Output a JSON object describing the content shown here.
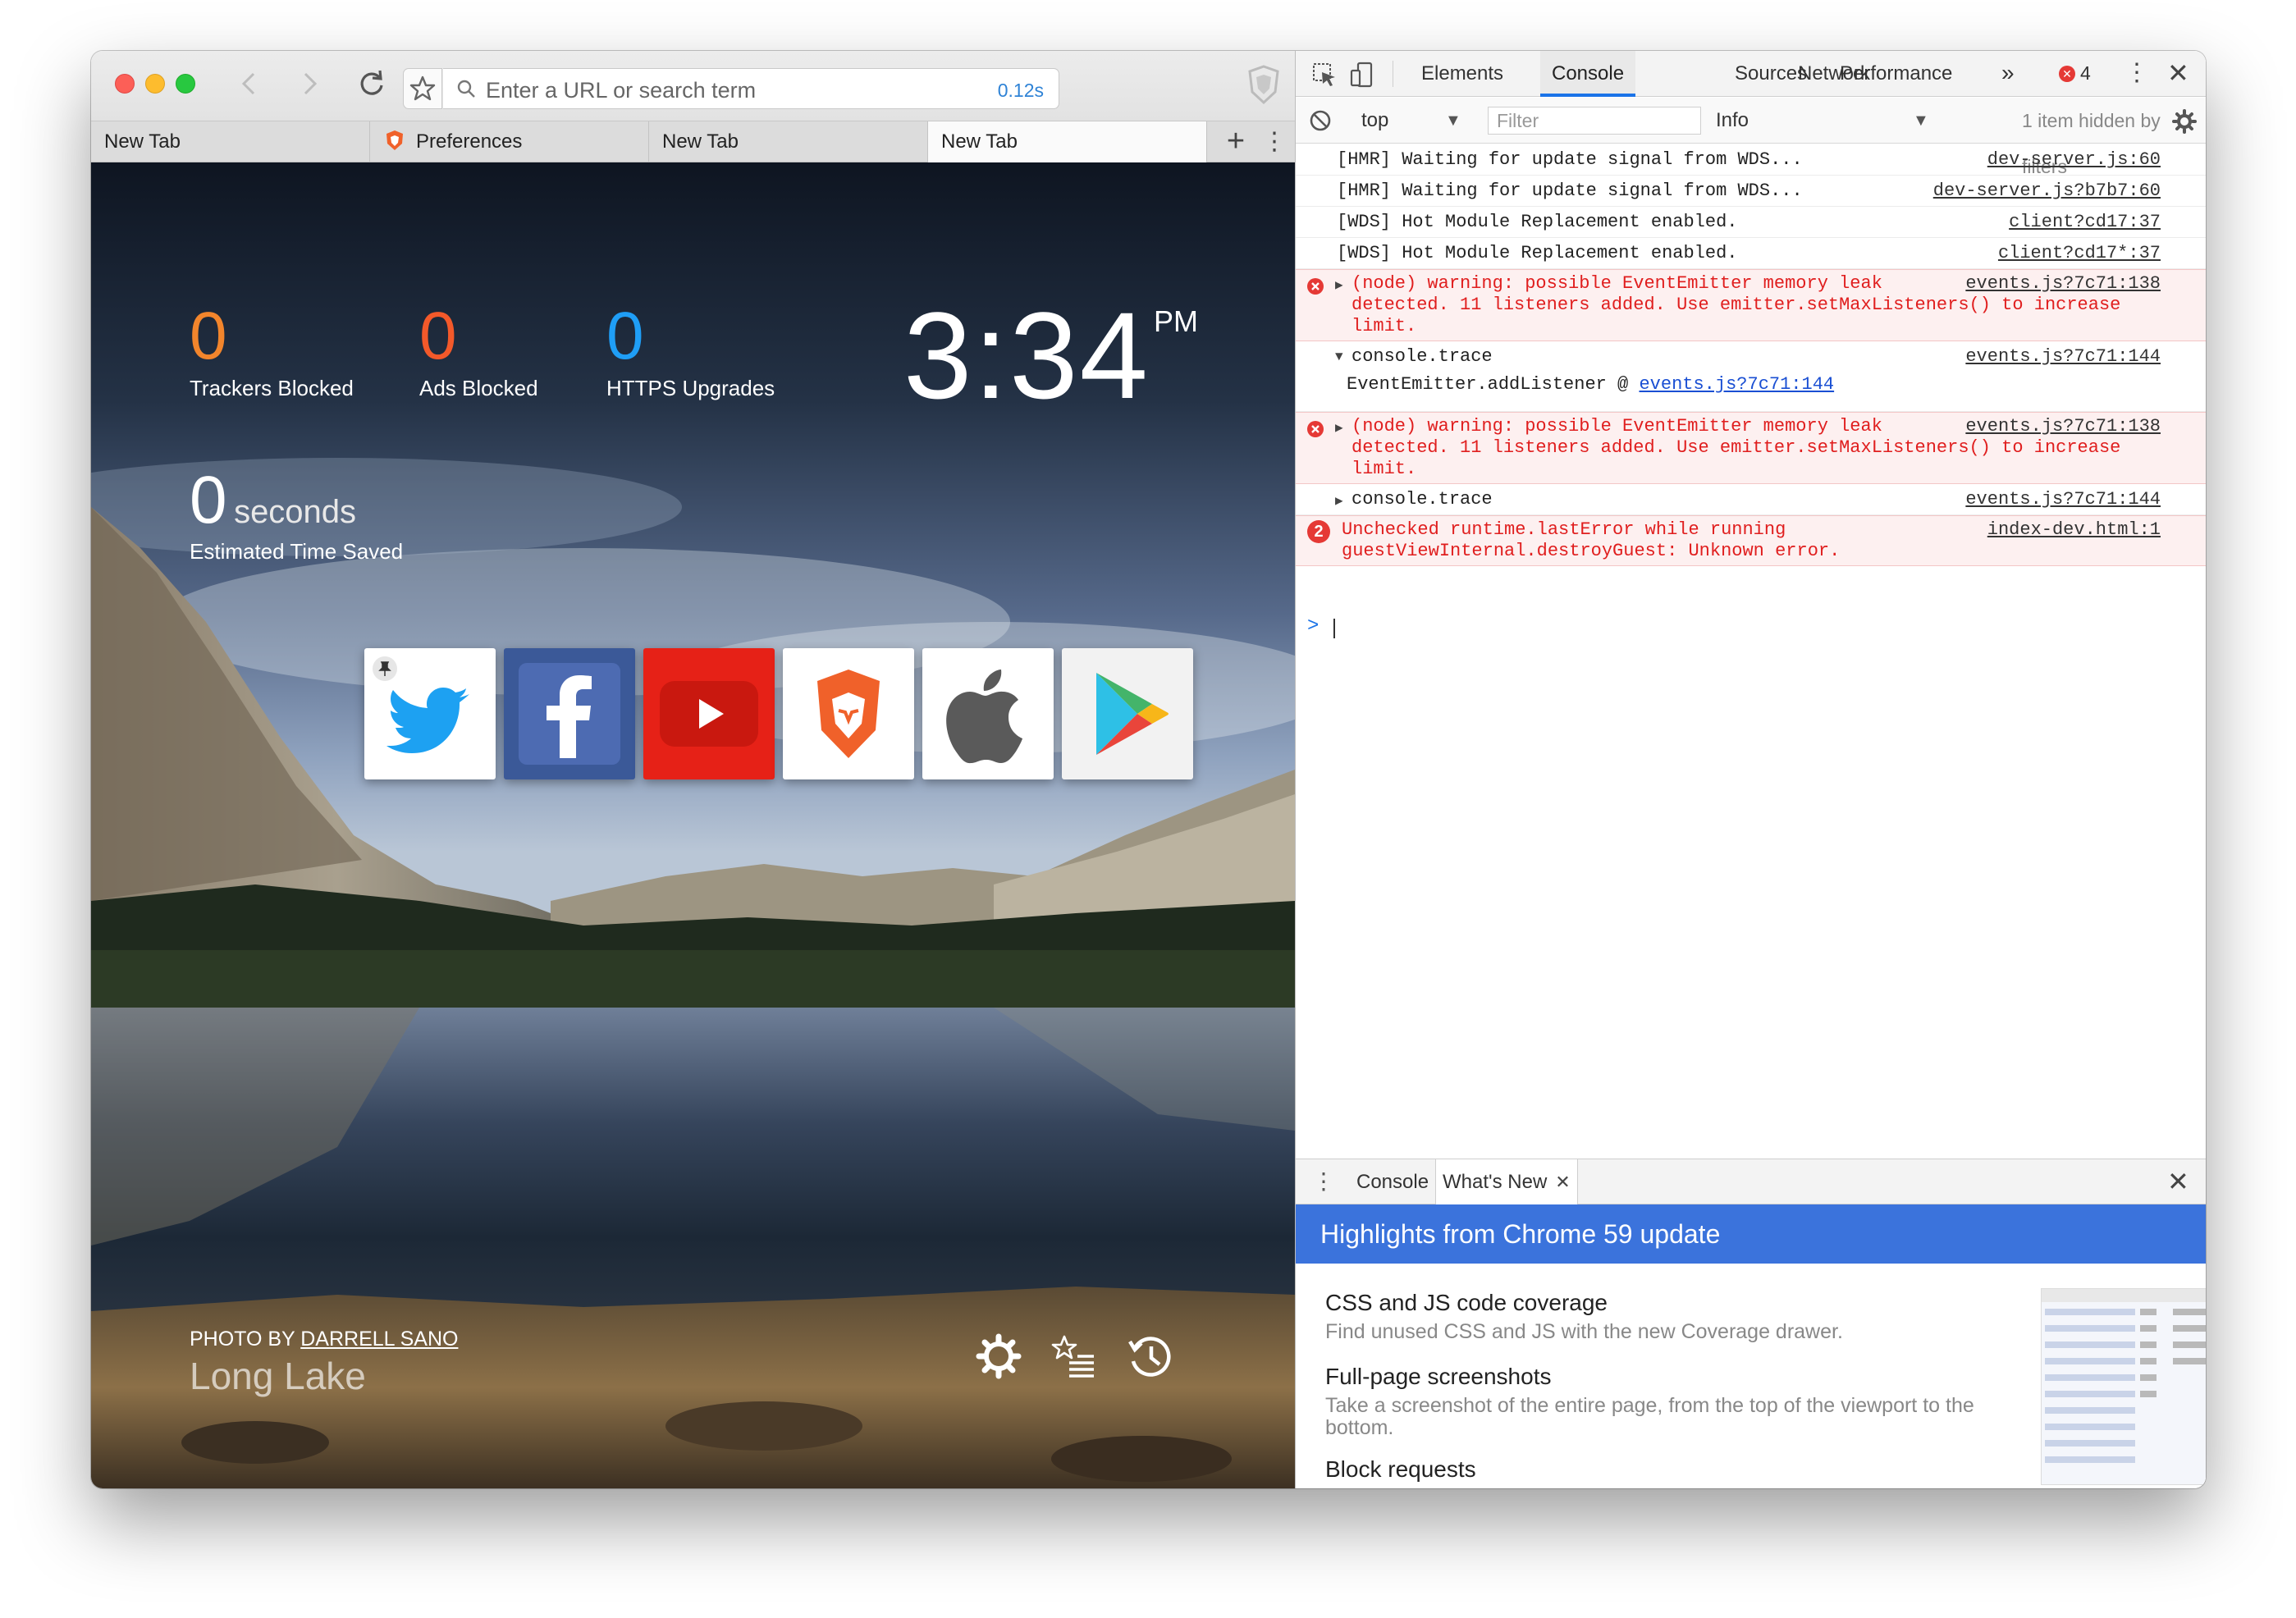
{
  "browser": {
    "url_placeholder": "Enter a URL or search term",
    "load_timing": "0.12s",
    "tabs": [
      {
        "label": "New Tab",
        "active": false
      },
      {
        "label": "Preferences",
        "active": false,
        "icon": "brave-lion-icon"
      },
      {
        "label": "New Tab",
        "active": false
      },
      {
        "label": "New Tab",
        "active": true
      }
    ],
    "add_tab_symbol": "+",
    "tab_menu_symbol": "⋮"
  },
  "new_tab_page": {
    "stats": [
      {
        "value": "0",
        "label": "Trackers Blocked",
        "color": "#f2852c"
      },
      {
        "value": "0",
        "label": "Ads Blocked",
        "color": "#f3592a"
      },
      {
        "value": "0",
        "label": "HTTPS Upgrades",
        "color": "#1f9ef6"
      }
    ],
    "time_saved": {
      "value": "0",
      "unit": "seconds",
      "label": "Estimated Time Saved"
    },
    "clock": {
      "time": "3:34",
      "ampm": "PM"
    },
    "top_sites": [
      {
        "name": "twitter-tile",
        "icon": "twitter-bird-icon",
        "bg": "#ffffff",
        "pinned": true
      },
      {
        "name": "facebook-tile",
        "icon": "facebook-f-icon",
        "bg": "#3b5998",
        "pinned": false
      },
      {
        "name": "youtube-tile",
        "icon": "youtube-play-icon",
        "bg": "#e62117",
        "pinned": false
      },
      {
        "name": "brave-tile",
        "icon": "brave-lion-icon",
        "bg": "#ffffff",
        "pinned": false
      },
      {
        "name": "apple-tile",
        "icon": "apple-logo-icon",
        "bg": "#ffffff",
        "pinned": false
      },
      {
        "name": "google-play-tile",
        "icon": "google-play-icon",
        "bg": "#f2f2f2",
        "pinned": false
      }
    ],
    "photo_credit_prefix": "PHOTO BY",
    "photo_author": "DARRELL SANO",
    "photo_title": "Long Lake",
    "bottom_icons": [
      "settings-gear-icon",
      "bookmarks-star-icon",
      "history-clock-icon"
    ]
  },
  "devtools": {
    "tabs": [
      "Elements",
      "Console",
      "Sources",
      "Network",
      "Performance"
    ],
    "active_tab": "Console",
    "more_tabs_symbol": "»",
    "error_count": "4",
    "console_toolbar": {
      "context": "top",
      "filter_placeholder": "Filter",
      "level": "Info",
      "hidden_note": "1 item hidden by filters"
    },
    "messages": [
      {
        "text": "[HMR] Waiting for update signal from WDS...",
        "source": "dev-server.js:60",
        "type": "log"
      },
      {
        "text": "[HMR] Waiting for update signal from WDS...",
        "source": "dev-server.js?b7b7:60",
        "type": "log"
      },
      {
        "text": "[WDS] Hot Module Replacement enabled.",
        "source": "client?cd17:37",
        "type": "log"
      },
      {
        "text": "[WDS] Hot Module Replacement enabled.",
        "source": "client?cd17*:37",
        "type": "log"
      },
      {
        "text": "(node) warning: possible EventEmitter memory leak\ndetected. 11 listeners added. Use emitter.setMaxListeners() to increase\nlimit.",
        "source": "events.js?7c71:138",
        "type": "error"
      },
      {
        "text": "console.trace",
        "source": "events.js?7c71:144",
        "type": "trace-open",
        "detail": "EventEmitter.addListener @ ",
        "detail_link": "events.js?7c71:144"
      },
      {
        "text": "(node) warning: possible EventEmitter memory leak\ndetected. 11 listeners added. Use emitter.setMaxListeners() to increase\nlimit.",
        "source": "events.js?7c71:138",
        "type": "error"
      },
      {
        "text": "console.trace",
        "source": "events.js?7c71:144",
        "type": "trace-closed"
      },
      {
        "text": "Unchecked runtime.lastError while running\nguestViewInternal.destroyGuest: Unknown error.",
        "source": "index-dev.html:1",
        "type": "error-count",
        "count": "2"
      }
    ],
    "prompt_symbol": ">",
    "drawer": {
      "tabs": [
        "Console",
        "What's New"
      ],
      "active_tab": "What's New",
      "banner": "Highlights from Chrome 59 update",
      "items": [
        {
          "title": "CSS and JS code coverage",
          "desc": "Find unused CSS and JS with the new Coverage drawer."
        },
        {
          "title": "Full-page screenshots",
          "desc": "Take a screenshot of the entire page, from the top of the viewport to the bottom."
        },
        {
          "title": "Block requests",
          "desc": ""
        }
      ]
    }
  }
}
